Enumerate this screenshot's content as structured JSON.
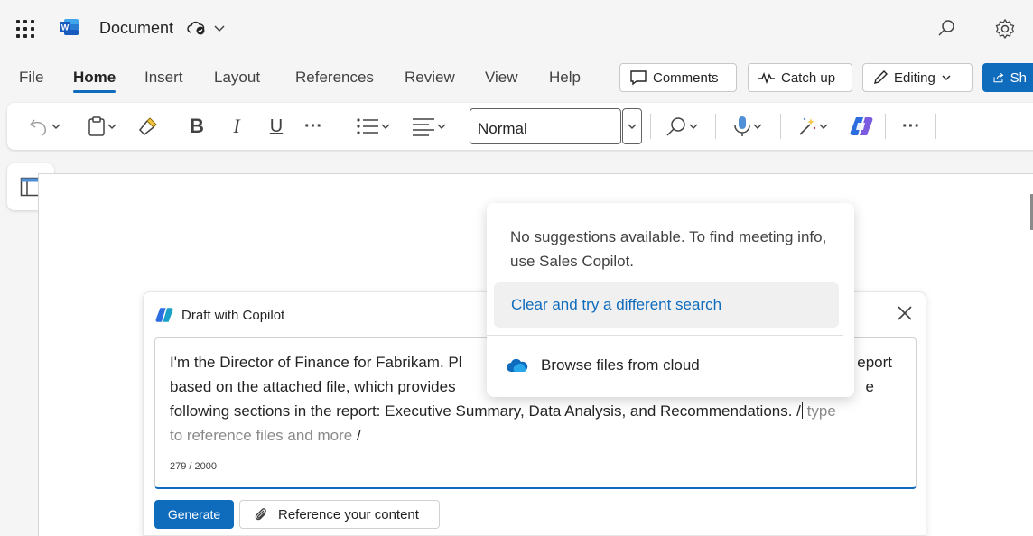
{
  "app": {
    "document_title": "Document",
    "icons": {
      "apps": "waffle-icon",
      "logo": "word-logo",
      "saved": "cloud-saved-icon",
      "search": "search-icon",
      "settings": "gear-icon"
    }
  },
  "tabs": [
    {
      "label": "File"
    },
    {
      "label": "Home"
    },
    {
      "label": "Insert"
    },
    {
      "label": "Layout"
    },
    {
      "label": "References"
    },
    {
      "label": "Review"
    },
    {
      "label": "View"
    },
    {
      "label": "Help"
    }
  ],
  "actions": {
    "comments": "Comments",
    "catchup": "Catch up",
    "editing": "Editing",
    "share": "Sh"
  },
  "ribbon": {
    "bold": "B",
    "italic": "I",
    "underline": "U",
    "more": "···",
    "style_value": "Normal"
  },
  "copilot": {
    "title": "Draft with Copilot",
    "prompt_line1": "I'm the Director of Finance for Fabrikam. Pl",
    "prompt_line1_end": "eport",
    "prompt_line2": "based on the attached file, which provides",
    "prompt_line2_end": "e",
    "prompt_line3": "following sections in the report: Executive Summary, Data Analysis, and Recommendations. /",
    "hint_a": "type",
    "hint_b": "to reference files and more",
    "trailing_slash": "/",
    "char_count": "279 / 2000",
    "generate_label": "Generate",
    "reference_label": "Reference your content"
  },
  "suggestions": {
    "message": "No suggestions available. To find meeting info, use Sales Copilot.",
    "clear_label": "Clear and try a different search",
    "browse_label": "Browse files from cloud"
  },
  "colors": {
    "accent": "#0f6cbd",
    "word_blue": "#185abd"
  }
}
